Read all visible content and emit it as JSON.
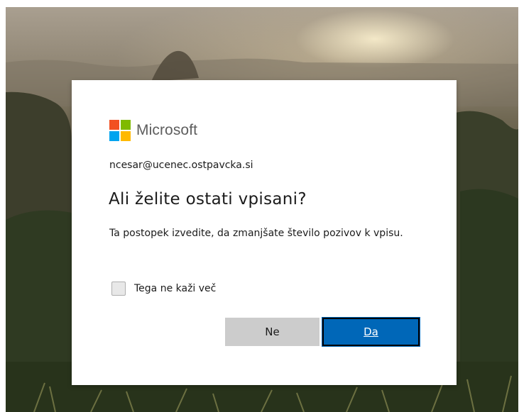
{
  "brand": {
    "name": "Microsoft",
    "logo_colors": [
      "#f25022",
      "#7fba00",
      "#00a4ef",
      "#ffb900"
    ]
  },
  "dialog": {
    "identity": "ncesar@ucenec.ostpavcka.si",
    "title": "Ali želite ostati vpisani?",
    "description": "Ta postopek izvedite, da zmanjšate število pozivov k vpisu.",
    "checkbox": {
      "label": "Tega ne kaži več",
      "checked": false
    },
    "buttons": {
      "no_label": "Ne",
      "yes_label": "Da"
    }
  },
  "colors": {
    "primary_button": "#0067b8",
    "secondary_button": "#cccccc"
  }
}
